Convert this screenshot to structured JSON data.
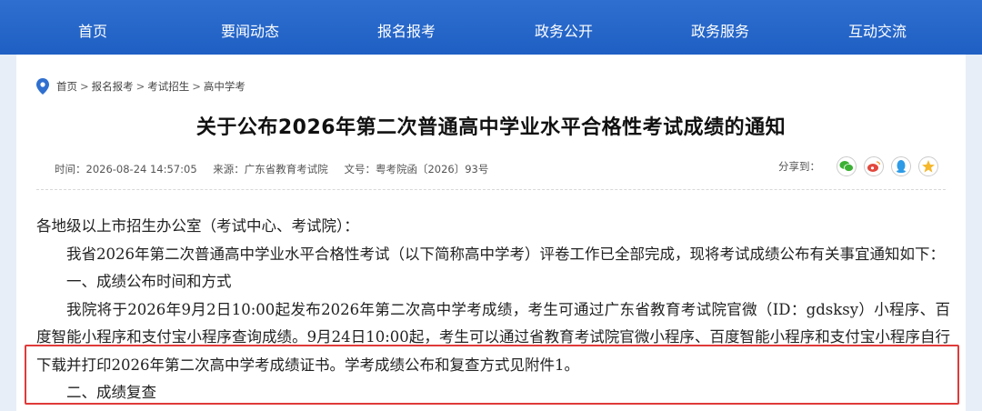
{
  "nav": {
    "items": [
      {
        "label": "首页"
      },
      {
        "label": "要闻动态"
      },
      {
        "label": "报名报考"
      },
      {
        "label": "政务公开"
      },
      {
        "label": "政务服务"
      },
      {
        "label": "互动交流"
      }
    ]
  },
  "breadcrumb": {
    "items": [
      "首页",
      "报名报考",
      "考试招生",
      "高中学考"
    ],
    "separator": ">"
  },
  "article": {
    "title": "关于公布2026年第二次普通高中学业水平合格性考试成绩的通知",
    "meta": {
      "time": "时间：2026-08-24 14:57:05",
      "source": "来源：广东省教育考试院",
      "doc_no": "文号：粤考院函〔2026〕93号"
    },
    "share_label": "分享到：",
    "share_icons": [
      "wechat-icon",
      "weibo-icon",
      "qq-icon",
      "qzone-icon"
    ],
    "paragraphs": [
      "各地级以上市招生办公室（考试中心、考试院）：",
      "我省2026年第二次普通高中学业水平合格性考试（以下简称高中学考）评卷工作已全部完成，现将考试成绩公布有关事宜通知如下：",
      "一、成绩公布时间和方式",
      "我院将于2026年9月2日10:00起发布2026年第二次高中学考成绩，考生可通过广东省教育考试院官微（ID：gdsksy）小程序、百度智能小程序和支付宝小程序查询成绩。9月24日10:00起，考生可以通过省教育考试院官微小程序、百度智能小程序和支付宝小程序自行下载并打印2026年第二次高中学考成绩证书。学考成绩公布和复查方式见附件1。",
      "二、成绩复查"
    ]
  },
  "colors": {
    "nav_bg": "#1f5fc4",
    "highlight_border": "#e03a3a",
    "page_bg": "#e7eef7"
  }
}
